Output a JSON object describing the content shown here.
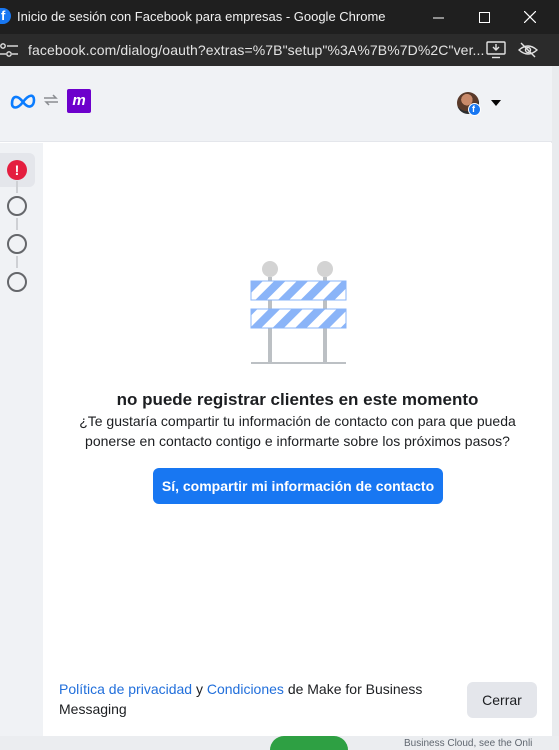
{
  "window": {
    "title": "Inicio de sesión con Facebook para empresas - Google Chrome",
    "favicon_icon": "facebook-icon"
  },
  "address_bar": {
    "url": "facebook.com/dialog/oauth?extras=%7B\"setup\"%3A%7B%7D%2C\"ver..."
  },
  "header": {
    "icons": [
      "meta-logo-icon",
      "swap-arrows-icon",
      "make-logo-icon",
      "avatar",
      "caret-down-icon"
    ],
    "make_logo_letter": "m"
  },
  "steps": {
    "items": [
      "error",
      "pending",
      "pending",
      "pending"
    ],
    "error_glyph": "!"
  },
  "main": {
    "heading": "no puede registrar clientes en este momento",
    "subtext": "¿Te gustaría compartir tu información de contacto con para que pueda ponerse en contacto contigo e informarte sobre los próximos pasos?",
    "share_button": "Sí, compartir mi información de contacto"
  },
  "footer": {
    "privacy_link": "Política de privacidad",
    "and": "y",
    "terms_link": "Condiciones",
    "suffix": "de Make for Business Messaging",
    "close_button": "Cerrar"
  },
  "background_page": {
    "partial_text": "Business Cloud, see the Onli"
  },
  "colors": {
    "accent": "#1877f2",
    "error": "#e41e3f",
    "make_brand": "#6d00cc",
    "link": "#216fdb"
  }
}
